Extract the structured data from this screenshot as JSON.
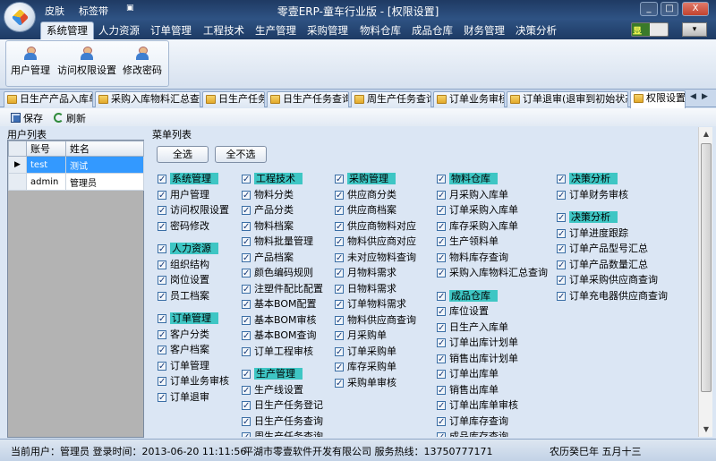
{
  "window": {
    "title": "零壹ERP-童车行业版 - [权限设置]",
    "quick_access": [
      "皮肤",
      "标签带"
    ],
    "controls": {
      "minimize": "_",
      "maximize": "□",
      "close": "X"
    }
  },
  "menubar": {
    "items": [
      "系统管理",
      "人力资源",
      "订单管理",
      "工程技术",
      "生产管理",
      "采购管理",
      "物料仓库",
      "成品仓库",
      "财务管理",
      "决策分析"
    ],
    "active": "系统管理",
    "skin_label": "显"
  },
  "ribbon": {
    "buttons": [
      "用户管理",
      "访问权限设置",
      "修改密码"
    ]
  },
  "doc_tabs": {
    "items": [
      "日生产产品入库单",
      "采购入库物料汇总查询",
      "日生产任务",
      "日生产任务查询",
      "周生产任务查询",
      "订单业务审核",
      "订单退审(退审到初始状态)",
      "权限设置"
    ],
    "active": "权限设置"
  },
  "toolbar": {
    "save": "保存",
    "refresh": "刷新"
  },
  "user_list": {
    "label": "用户列表",
    "columns": [
      "账号",
      "姓名"
    ],
    "rows": [
      {
        "account": "test",
        "name": "测试",
        "selected": true
      },
      {
        "account": "admin",
        "name": "管理员",
        "selected": false
      }
    ]
  },
  "menu_list": {
    "label": "菜单列表",
    "select_all": "全选",
    "select_none": "全不选",
    "columns": [
      [
        {
          "header": "系统管理",
          "items": [
            "用户管理",
            "访问权限设置",
            "密码修改"
          ]
        },
        {
          "header": "人力资源",
          "items": [
            "组织结构",
            "岗位设置",
            "员工档案"
          ]
        },
        {
          "header": "订单管理",
          "items": [
            "客户分类",
            "客户档案",
            "订单管理",
            "订单业务审核",
            "订单退审"
          ]
        }
      ],
      [
        {
          "header": "工程技术",
          "items": [
            "物料分类",
            "产品分类",
            "物料档案",
            "物料批量管理",
            "产品档案",
            "颜色编码规则",
            "注塑件配比配置",
            "基本BOM配置",
            "基本BOM审核",
            "基本BOM查询",
            "订单工程审核"
          ]
        },
        {
          "header": "生产管理",
          "items": [
            "生产线设置",
            "日生产任务登记",
            "日生产任务查询",
            "周生产任务查询"
          ]
        }
      ],
      [
        {
          "header": "采购管理",
          "items": [
            "供应商分类",
            "供应商档案",
            "供应商物料对应",
            "物料供应商对应",
            "未对应物料查询",
            "月物料需求",
            "日物料需求",
            "订单物料需求",
            "物料供应商查询",
            "月采购单",
            "订单采购单",
            "库存采购单",
            "采购单审核"
          ]
        }
      ],
      [
        {
          "header": "物料仓库",
          "items": [
            "月采购入库单",
            "订单采购入库单",
            "库存采购入库单",
            "生产领料单",
            "物料库存查询",
            "采购入库物料汇总查询"
          ]
        },
        {
          "header": "成品仓库",
          "items": [
            "库位设置",
            "日生产入库单",
            "订单出库计划单",
            "销售出库计划单",
            "订单出库单",
            "销售出库单",
            "订单出库单审核",
            "订单库存查询",
            "成品库存查询"
          ]
        }
      ],
      [
        {
          "header": "决策分析",
          "items": [
            "订单财务审核"
          ]
        },
        {
          "header": "决策分析",
          "items": [
            "订单进度跟踪",
            "订单产品型号汇总",
            "订单产品数量汇总",
            "订单采购供应商查询",
            "订单充电器供应商查询"
          ]
        }
      ]
    ]
  },
  "statusbar": {
    "user": "当前用户：管理员 登录时间：2013-06-20 11:11:56",
    "company": "平湖市零壹软件开发有限公司 服务热线：13750777171",
    "lunar": "农历癸巳年 五月十三"
  }
}
